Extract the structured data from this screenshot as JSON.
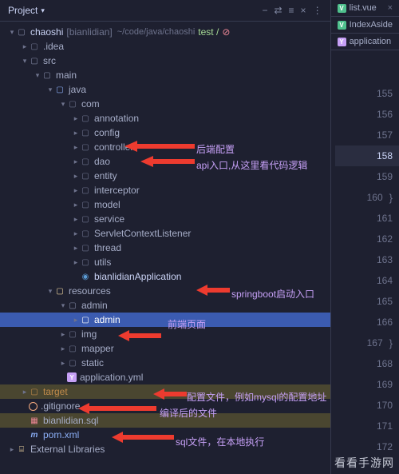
{
  "panel": {
    "title": "Project"
  },
  "actions": [
    "−",
    "⇄",
    "≡",
    "×",
    "⋮"
  ],
  "root": {
    "name": "chaoshi",
    "qualifier": "[bianlidian]",
    "path": "~/code/java/chaoshi",
    "test": "test /",
    "slash": "⊘"
  },
  "idea": ".idea",
  "src": "src",
  "main": "main",
  "java": "java",
  "com": "com",
  "pk": [
    "annotation",
    "config",
    "controller",
    "dao",
    "entity",
    "interceptor",
    "model",
    "service",
    "ServletContextListener",
    "thread",
    "utils"
  ],
  "app": "bianlidianApplication",
  "resources": "resources",
  "admin1": "admin",
  "admin2": "admin",
  "res_pk": [
    "img",
    "mapper",
    "static"
  ],
  "appyml": "application.yml",
  "target": "target",
  "gitignore": ".gitignore",
  "sql": "bianlidian.sql",
  "pom": "pom.xml",
  "extlib": "External Libraries",
  "tabs": {
    "list": "list.vue",
    "index": "IndexAside",
    "appl": "application"
  },
  "lines": [
    "155",
    "156",
    "157",
    "158",
    "159",
    "160",
    "161",
    "162",
    "163",
    "164",
    "165",
    "166",
    "167",
    "168",
    "169",
    "170",
    "171",
    "172"
  ],
  "ann": {
    "config": "后端配置",
    "controller": "api入口,从这里看代码逻辑",
    "app": "springboot启动入口",
    "admin": "前端页面",
    "yml": "配置文件，例如mysql的配置地址",
    "target": "编译后的文件",
    "sql": "sql文件，在本地执行"
  },
  "watermark": "看看手游网"
}
